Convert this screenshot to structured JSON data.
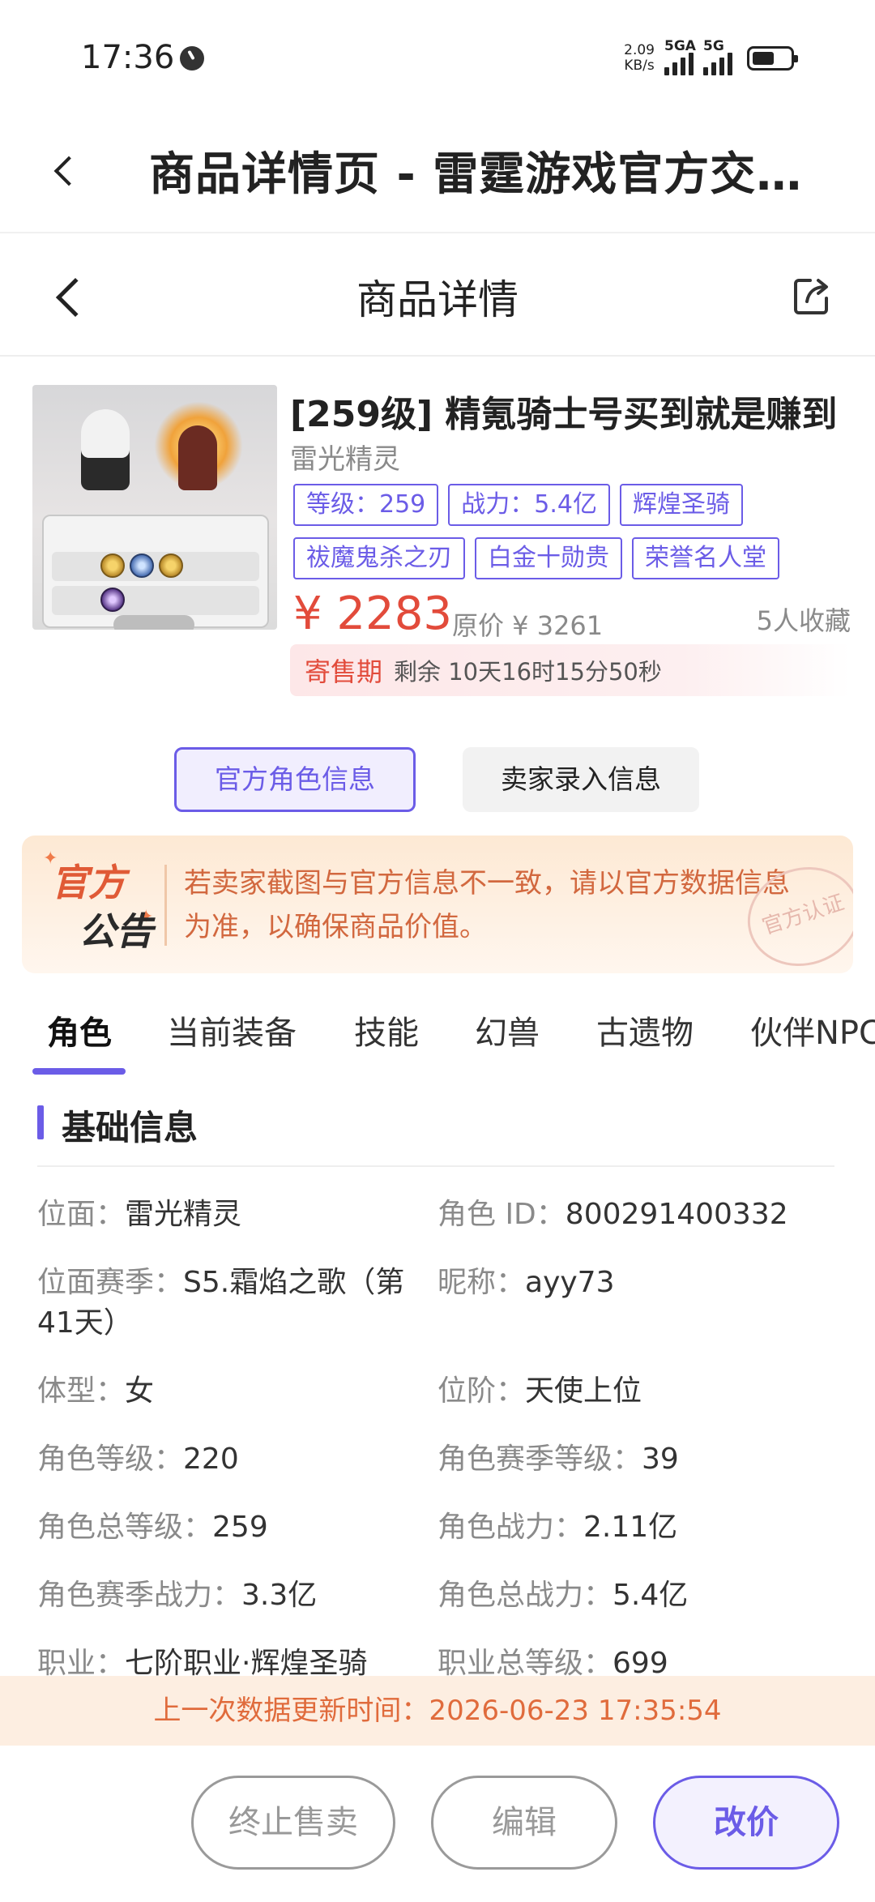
{
  "status_bar": {
    "time": "17:36",
    "net_speed_value": "2.09",
    "net_speed_unit": "KB/s",
    "signal1_label": "5GA",
    "signal2_label": "5G",
    "battery_level": 0.6
  },
  "app_header": {
    "title": "商品详情页 - 雷霆游戏官方交…"
  },
  "page_nav": {
    "title": "商品详情"
  },
  "product": {
    "title": "[259级] 精氪骑士号买到就是赚到",
    "subtitle": "雷光精灵",
    "tags": [
      "等级：259",
      "战力：5.4亿",
      "辉煌圣骑",
      "祓魔鬼杀之刃",
      "白金十勋贵",
      "荣誉名人堂"
    ],
    "price": "¥ 2283",
    "original_price": "原价 ¥ 3261",
    "favorites": "5人收藏",
    "sale_label": "寄售期",
    "sale_remaining": "剩余 10天16时15分50秒"
  },
  "toggle": {
    "official": "官方角色信息",
    "seller": "卖家录入信息"
  },
  "notice": {
    "badge_line1": "官方",
    "badge_line2": "公告",
    "text": "若卖家截图与官方信息不一致，请以官方数据信息为准，以确保商品价值。",
    "stamp": "官方认证"
  },
  "tabs": [
    "角色",
    "当前装备",
    "技能",
    "幻兽",
    "古遗物",
    "伙伴NPC"
  ],
  "section": {
    "title": "基础信息"
  },
  "fields": {
    "plane_k": "位面：",
    "plane_v": "雷光精灵",
    "role_id_k": "角色 ID：",
    "role_id_v": "800291400332",
    "season_k": "位面赛季：",
    "season_v1": "S5.霜焰之歌（第",
    "season_v2": "41天）",
    "nickname_k": "昵称：",
    "nickname_v": "ayy73",
    "body_k": "体型：",
    "body_v": "女",
    "rank_k": "位阶：",
    "rank_v": "天使上位",
    "level_k": "角色等级：",
    "level_v": "220",
    "season_level_k": "角色赛季等级：",
    "season_level_v": "39",
    "total_level_k": "角色总等级：",
    "total_level_v": "259",
    "power_k": "角色战力：",
    "power_v": "2.11亿",
    "season_power_k": "角色赛季战力：",
    "season_power_v": "3.3亿",
    "total_power_k": "角色总战力：",
    "total_power_v": "5.4亿",
    "job_k": "职业：",
    "job_v": "七阶职业·辉煌圣骑",
    "job_total_level_k": "职业总等级：",
    "job_total_level_v": "699"
  },
  "update": {
    "text": "上一次数据更新时间：2026-06-23 17:35:54"
  },
  "actions": {
    "stop_sale": "终止售卖",
    "edit": "编辑",
    "change_price": "改价"
  },
  "colors": {
    "accent": "#6b5ce7",
    "price": "#e24b3b",
    "notice_text": "#d2683f",
    "update_text": "#e06b3c"
  }
}
